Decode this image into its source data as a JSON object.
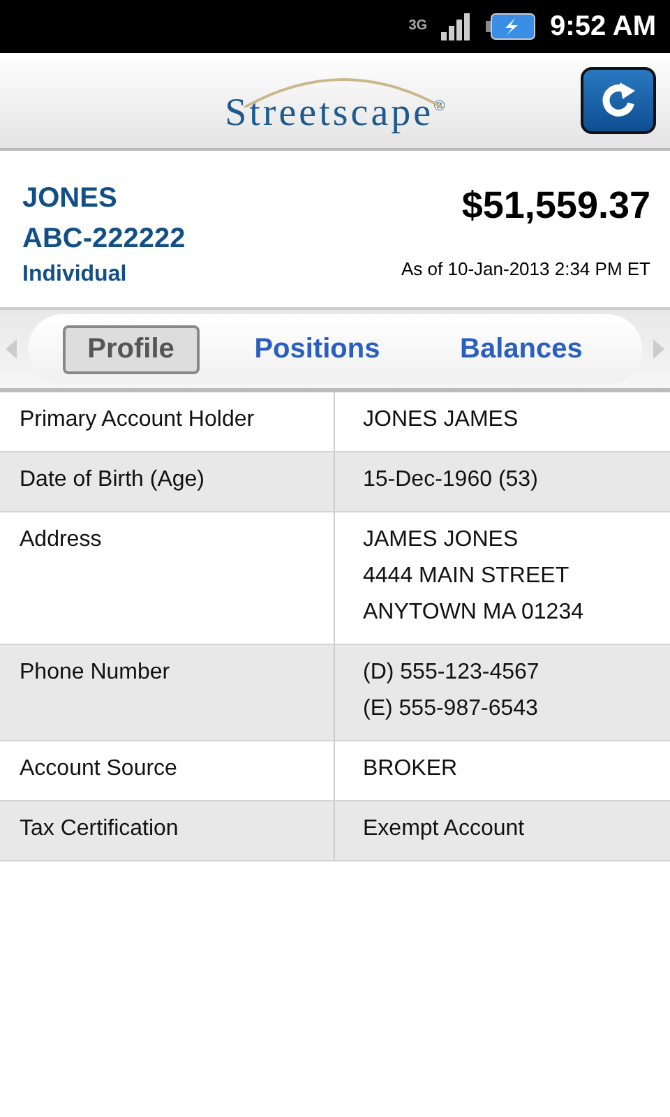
{
  "status_bar": {
    "network": "3G",
    "time": "9:52 AM"
  },
  "header": {
    "logo": "Streetscape",
    "logo_mark": "®"
  },
  "account": {
    "name": "JONES",
    "number": "ABC-222222",
    "type": "Individual",
    "balance": "$51,559.37",
    "as_of": "As of 10-Jan-2013 2:34 PM ET"
  },
  "tabs": [
    {
      "label": "Profile",
      "selected": true
    },
    {
      "label": "Positions",
      "selected": false
    },
    {
      "label": "Balances",
      "selected": false
    }
  ],
  "profile": [
    {
      "label": "Primary Account Holder",
      "lines": [
        "JONES JAMES"
      ]
    },
    {
      "label": "Date of Birth (Age)",
      "lines": [
        "15-Dec-1960 (53)"
      ]
    },
    {
      "label": "Address",
      "lines": [
        "JAMES JONES",
        "4444 MAIN STREET",
        "ANYTOWN MA 01234"
      ]
    },
    {
      "label": "Phone Number",
      "lines": [
        "(D) 555-123-4567",
        "(E) 555-987-6543"
      ]
    },
    {
      "label": "Account Source",
      "lines": [
        "BROKER"
      ]
    },
    {
      "label": "Tax Certification",
      "lines": [
        "Exempt Account"
      ]
    }
  ]
}
